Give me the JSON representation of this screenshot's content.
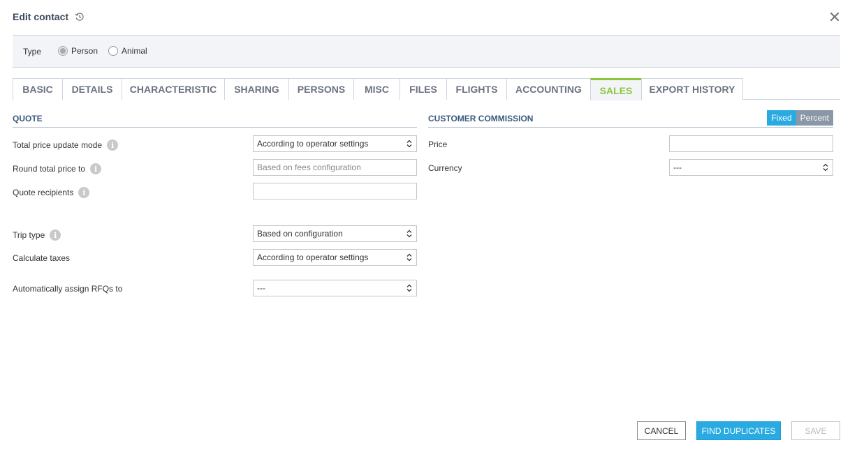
{
  "header": {
    "title": "Edit contact"
  },
  "type_bar": {
    "label": "Type",
    "options": [
      {
        "label": "Person",
        "checked": true
      },
      {
        "label": "Animal",
        "checked": false
      }
    ]
  },
  "tabs": [
    {
      "label": "BASIC"
    },
    {
      "label": "DETAILS"
    },
    {
      "label": "CHARACTERISTIC"
    },
    {
      "label": "SHARING"
    },
    {
      "label": "PERSONS"
    },
    {
      "label": "MISC"
    },
    {
      "label": "FILES"
    },
    {
      "label": "FLIGHTS"
    },
    {
      "label": "ACCOUNTING"
    },
    {
      "label": "SALES",
      "active": true
    },
    {
      "label": "EXPORT HISTORY"
    }
  ],
  "quote": {
    "title": "QUOTE",
    "total_price_update_mode": {
      "label": "Total price update mode",
      "value": "According to operator settings"
    },
    "round_total_price_to": {
      "label": "Round total price to",
      "placeholder": "Based on fees configuration"
    },
    "quote_recipients": {
      "label": "Quote recipients",
      "value": ""
    },
    "trip_type": {
      "label": "Trip type",
      "value": "Based on configuration"
    },
    "calculate_taxes": {
      "label": "Calculate taxes",
      "value": "According to operator settings"
    },
    "auto_assign_rfqs": {
      "label": "Automatically assign RFQs to",
      "value": "---"
    }
  },
  "customer_commission": {
    "title": "CUSTOMER COMMISSION",
    "toggle": {
      "fixed": "Fixed",
      "percent": "Percent",
      "selected": "Fixed"
    },
    "price": {
      "label": "Price",
      "value": ""
    },
    "currency": {
      "label": "Currency",
      "value": "---"
    }
  },
  "footer": {
    "cancel": "CANCEL",
    "find_duplicates": "FIND DUPLICATES",
    "save": "SAVE"
  },
  "colors": {
    "accent_blue": "#29abe2",
    "active_tab_green": "#8cc63f",
    "section_title": "#3a5a7c"
  }
}
